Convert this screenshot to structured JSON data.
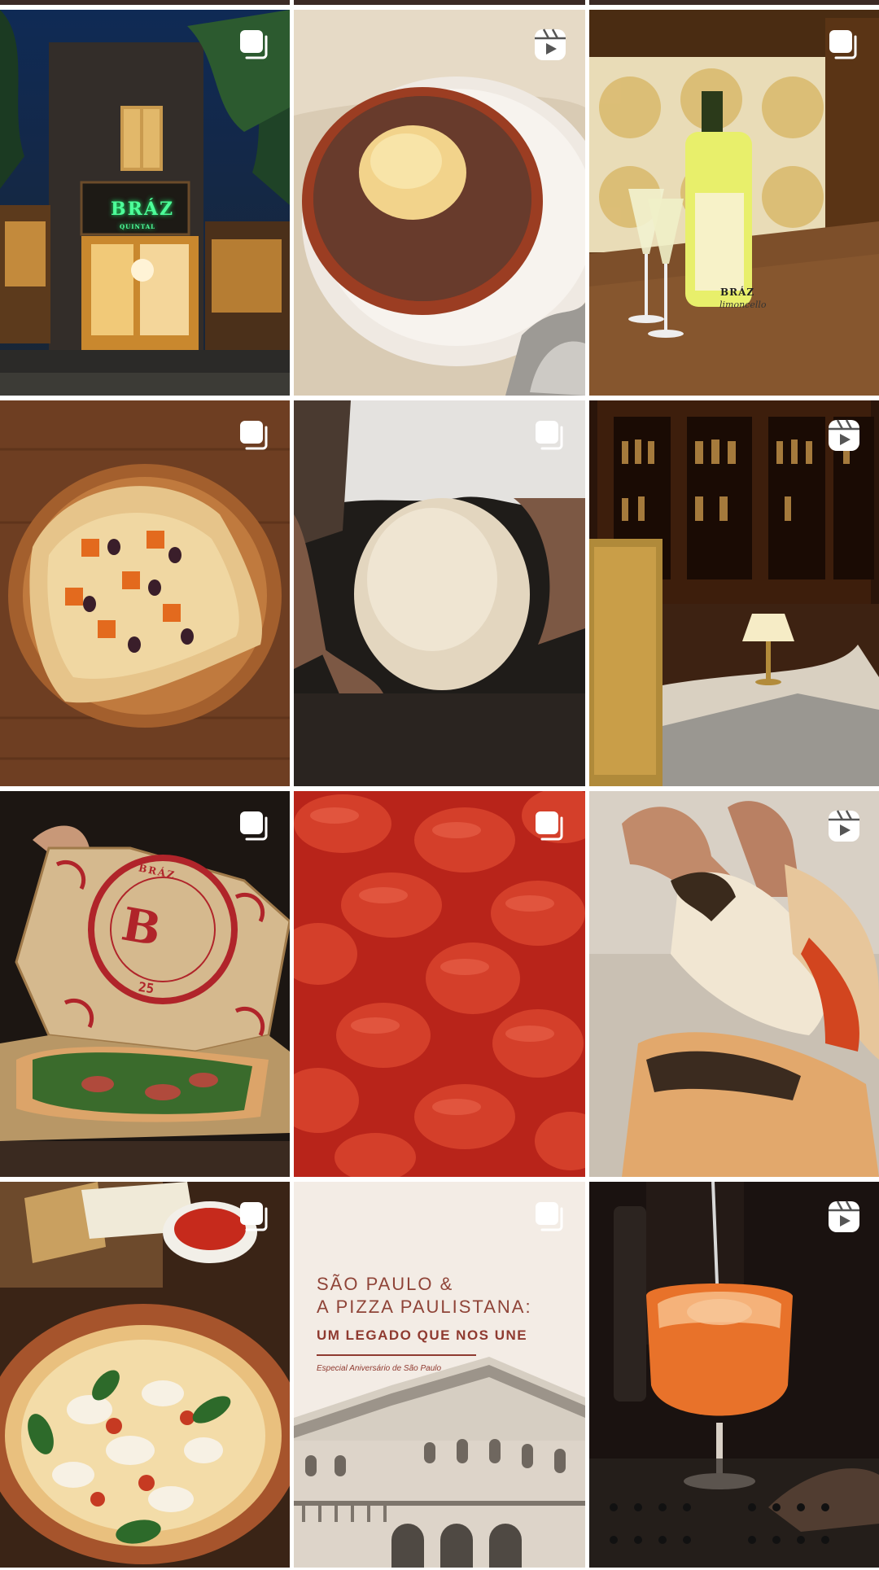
{
  "grid": {
    "posts": [
      {
        "scene": "restaurant-facade-night",
        "badge": "carousel-icon",
        "sign_text": "BRÁZ",
        "sign_subtext": "QUINTAL"
      },
      {
        "scene": "chocolate-dessert-with-ice-cream",
        "badge": "reels-icon"
      },
      {
        "scene": "limoncello-bottle-and-glasses",
        "badge": "carousel-icon",
        "bottle_brand": "BRÁZ",
        "bottle_name": "limoncello"
      },
      {
        "scene": "pizza-on-wooden-board",
        "badge": "carousel-icon"
      },
      {
        "scene": "chef-holding-dough",
        "badge": "carousel-icon"
      },
      {
        "scene": "bar-interior-with-lamp",
        "badge": "reels-icon"
      },
      {
        "scene": "pizza-box-with-pizza",
        "badge": "carousel-icon",
        "box_brand": "BRÁZ",
        "box_letter": "B",
        "box_year": "25"
      },
      {
        "scene": "peeled-tomatoes-closeup",
        "badge": "carousel-icon"
      },
      {
        "scene": "hand-tearing-pizza-crust",
        "badge": "reels-icon"
      },
      {
        "scene": "margherita-pizza-with-cheese",
        "badge": "carousel-icon"
      },
      {
        "scene": "sao-paulo-poster",
        "badge": "carousel-icon",
        "poster_line1": "SÃO PAULO &",
        "poster_line2": "A PIZZA PAULISTANA:",
        "poster_line3": "UM LEGADO QUE NOS UNE",
        "poster_line4": "Especial Aniversário de São Paulo"
      },
      {
        "scene": "orange-cocktail-spritz",
        "badge": "reels-icon"
      }
    ]
  },
  "colors": {
    "badge": "#ffffff",
    "poster_text": "#8f4438",
    "neon_sign": "#4dff9a",
    "box_print": "#b0242a",
    "page_background": "#ffffff"
  }
}
